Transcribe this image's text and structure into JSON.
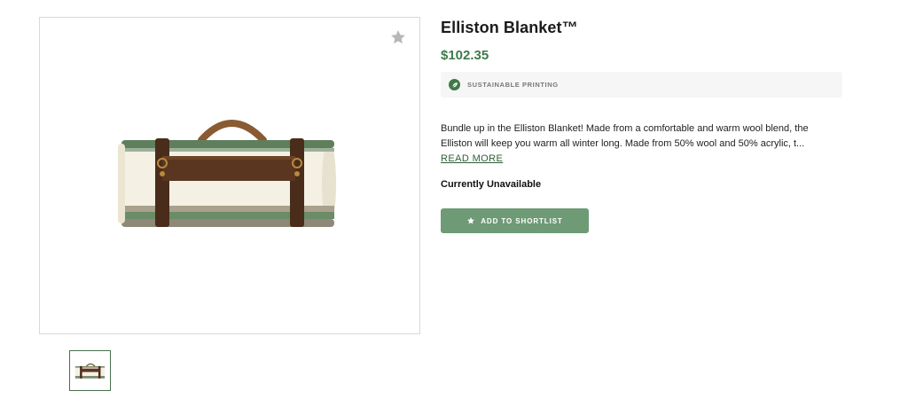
{
  "product": {
    "title": "Elliston Blanket™",
    "price": "$102.35",
    "badge": {
      "icon": "leaf-icon",
      "text": "SUSTAINABLE PRINTING"
    },
    "description_lines": [
      "Bundle up in the Elliston Blanket! Made from a comfortable and warm wool blend, the",
      "Elliston will keep you warm all winter long. Made from 50% wool and 50% acrylic, t..."
    ],
    "read_more_label": "READ MORE",
    "availability": "Currently Unavailable",
    "add_button_label": "ADD TO SHORTLIST"
  },
  "gallery": {
    "main_image": "rolled wool blanket with leather carry strap",
    "thumbnail_count": 1,
    "shortlist_icon": "star-icon"
  },
  "colors": {
    "accent_green": "#3f7a49",
    "button_green": "#6e9a75",
    "badge_bg": "#f6f6f6"
  }
}
